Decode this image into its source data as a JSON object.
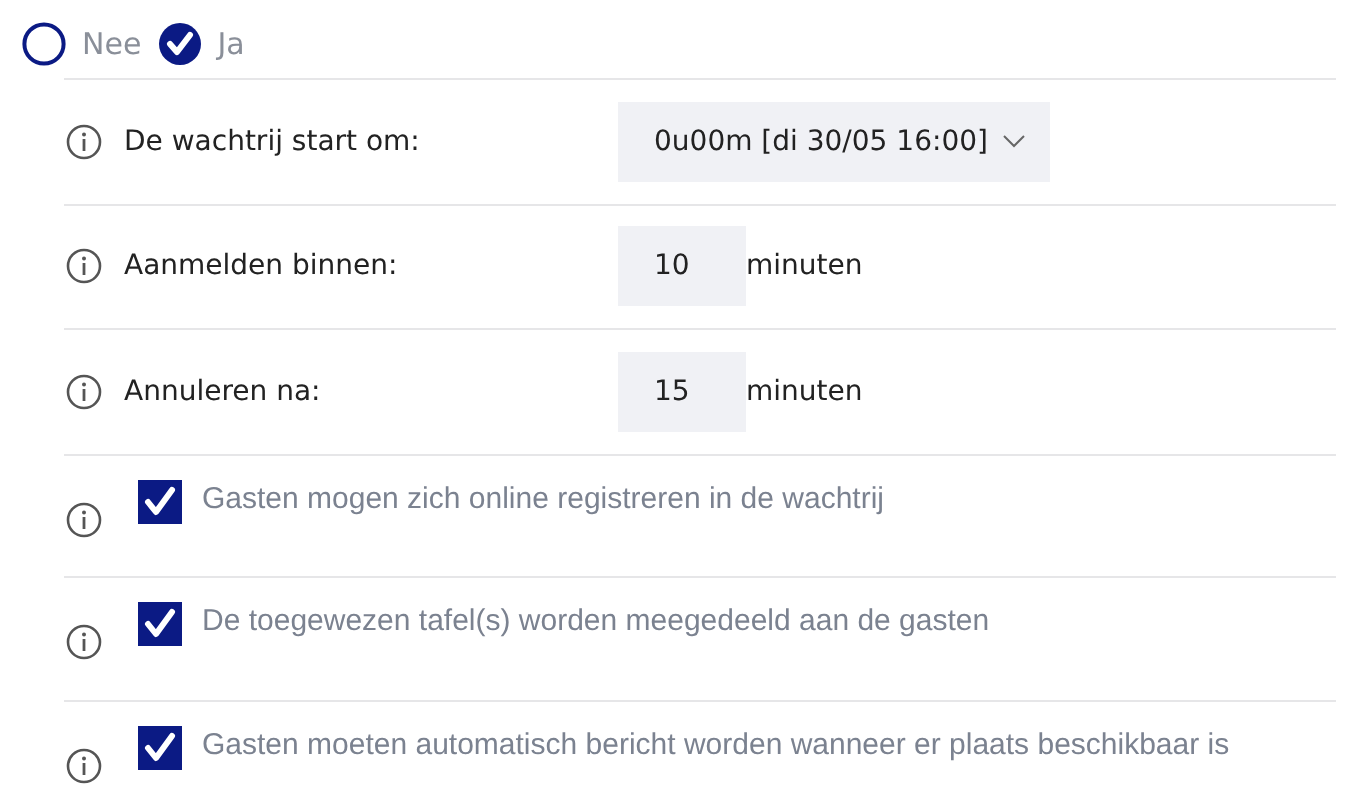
{
  "toggle": [
    {
      "label": "Nee",
      "selected": false
    },
    {
      "label": "Ja",
      "selected": true
    }
  ],
  "settings": [
    {
      "kind": "select",
      "label": "De wachtrij start om:",
      "value": "0u00m [di 30/05 16:00]"
    },
    {
      "kind": "number",
      "label": "Aanmelden binnen:",
      "value": "10",
      "unit": "minuten"
    },
    {
      "kind": "number",
      "label": "Annuleren na:",
      "value": "15",
      "unit": "minuten"
    },
    {
      "kind": "checkbox",
      "label": "Gasten mogen zich online registreren in de wachtrij",
      "checked": true
    },
    {
      "kind": "checkbox",
      "label": "De toegewezen tafel(s) worden meegedeeld aan de gasten",
      "checked": true
    },
    {
      "kind": "checkbox",
      "label": "Gasten moeten automatisch bericht worden wanneer er plaats beschikbaar is",
      "checked": true
    }
  ]
}
